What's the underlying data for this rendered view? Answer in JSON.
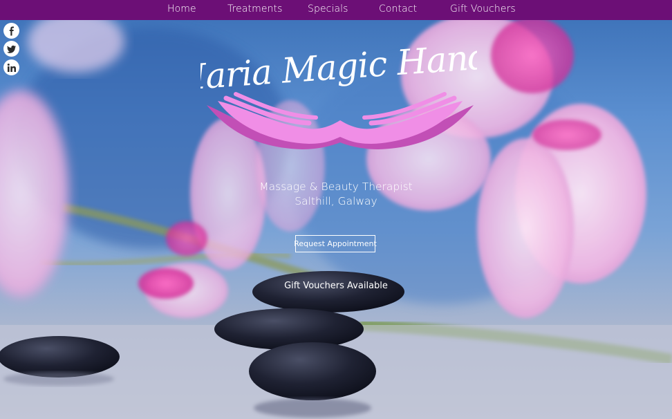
{
  "nav": {
    "items": [
      {
        "label": "Home"
      },
      {
        "label": "Treatments"
      },
      {
        "label": "Specials"
      },
      {
        "label": "Contact"
      },
      {
        "label": "Gift Vouchers"
      }
    ]
  },
  "social": [
    {
      "icon": "facebook-icon",
      "glyph": "f"
    },
    {
      "icon": "twitter-icon",
      "glyph": "t"
    },
    {
      "icon": "linkedin-icon",
      "glyph": "in"
    }
  ],
  "hero": {
    "brand": "Maria Magic Hands",
    "tagline_line1": "Massage & Beauty Therapist",
    "tagline_line2": "Salthill, Galway",
    "cta_label": "Request Appointment",
    "vouchers_text": "Gift Vouchers Available"
  },
  "colors": {
    "nav_bg": "#6c0f76",
    "hands_pink": "#f08ee6",
    "hands_dark": "#c24fb6",
    "text": "#ffffff"
  }
}
